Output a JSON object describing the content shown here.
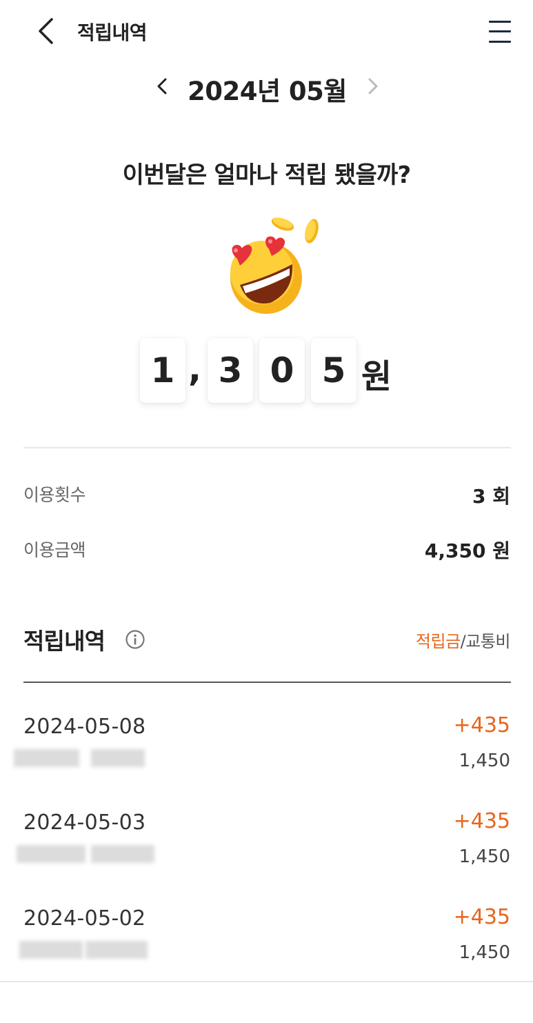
{
  "header": {
    "title": "적립내역",
    "back_icon": "chevron-left-icon",
    "menu_icon": "hamburger-menu-icon"
  },
  "month_nav": {
    "label": "2024년 05월"
  },
  "summary": {
    "question": "이번달은 얼마나 적립 됐을까?",
    "digits": [
      "1",
      "3",
      "0",
      "5"
    ],
    "separator": ",",
    "unit": "원",
    "emoji": "heart-eyes-smiley-with-coins"
  },
  "stats": [
    {
      "label": "이용횟수",
      "value": "3 회"
    },
    {
      "label": "이용금액",
      "value": "4,350 원"
    }
  ],
  "history": {
    "title": "적립내역",
    "toggle_active": "적립금",
    "toggle_separator": "/",
    "toggle_inactive": "교통비",
    "items": [
      {
        "date": "2024-05-08",
        "points": "+435",
        "fare": "1,450"
      },
      {
        "date": "2024-05-03",
        "points": "+435",
        "fare": "1,450"
      },
      {
        "date": "2024-05-02",
        "points": "+435",
        "fare": "1,450"
      }
    ]
  },
  "colors": {
    "accent": "#e8651c",
    "text": "#222222",
    "menu": "#1e2a3a"
  }
}
